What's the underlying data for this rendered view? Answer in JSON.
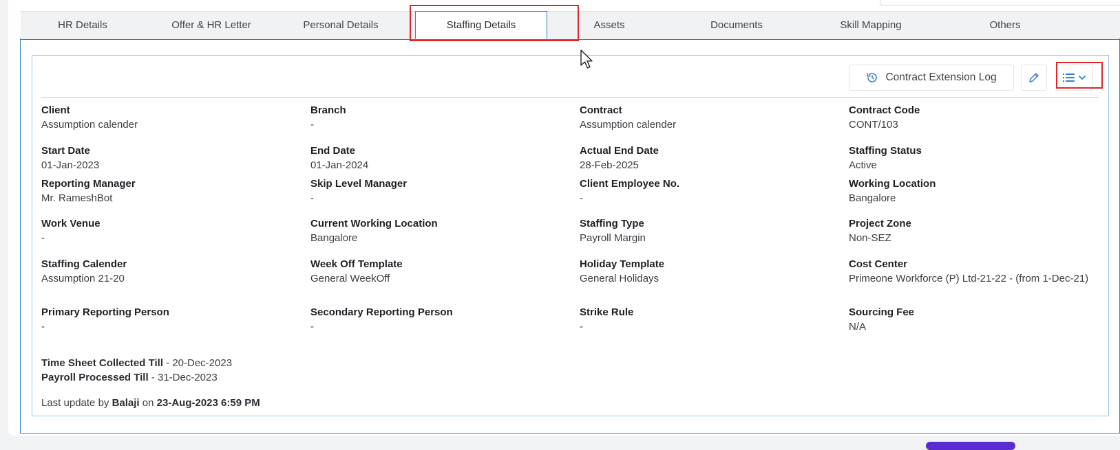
{
  "tabs": [
    {
      "label": "HR Details",
      "active": false
    },
    {
      "label": "Offer & HR Letter",
      "active": false
    },
    {
      "label": "Personal Details",
      "active": false
    },
    {
      "label": "Staffing Details",
      "active": true
    },
    {
      "label": "Assets",
      "active": false
    },
    {
      "label": "Documents",
      "active": false
    },
    {
      "label": "Skill Mapping",
      "active": false
    },
    {
      "label": "Others",
      "active": false
    }
  ],
  "toolbar": {
    "contract_log_label": "Contract Extension Log",
    "contract_log_icon": "history-icon",
    "edit_icon": "pencil-icon",
    "menu_icon": "list-icon",
    "menu_chevron_icon": "chevron-down-icon"
  },
  "fields": [
    {
      "label": "Client",
      "value": "Assumption calender"
    },
    {
      "label": "Branch",
      "value": "-"
    },
    {
      "label": "Contract",
      "value": "Assumption calender"
    },
    {
      "label": "Contract Code",
      "value": "CONT/103"
    },
    {
      "label": "Start Date",
      "value": "01-Jan-2023"
    },
    {
      "label": "End Date",
      "value": "01-Jan-2024"
    },
    {
      "label": "Actual End Date",
      "value": "28-Feb-2025"
    },
    {
      "label": "Staffing Status",
      "value": "Active"
    },
    {
      "label": "Reporting Manager",
      "value": "Mr. RameshBot"
    },
    {
      "label": "Skip Level Manager",
      "value": "-"
    },
    {
      "label": "Client Employee No.",
      "value": "-"
    },
    {
      "label": "Working Location",
      "value": "Bangalore"
    },
    {
      "label": "Work Venue",
      "value": "-"
    },
    {
      "label": "Current Working Location",
      "value": "Bangalore"
    },
    {
      "label": "Staffing Type",
      "value": "Payroll Margin"
    },
    {
      "label": "Project Zone",
      "value": "Non-SEZ"
    },
    {
      "label": "Staffing Calender",
      "value": "Assumption 21-20"
    },
    {
      "label": "Week Off Template",
      "value": "General WeekOff"
    },
    {
      "label": "Holiday Template",
      "value": "General Holidays"
    },
    {
      "label": "Cost Center",
      "value": "Primeone Workforce (P) Ltd-21-22 - (from 1-Dec-21)"
    },
    {
      "label": "Primary Reporting Person",
      "value": "-"
    },
    {
      "label": "Secondary Reporting Person",
      "value": "-"
    },
    {
      "label": "Strike Rule",
      "value": "-"
    },
    {
      "label": "Sourcing Fee",
      "value": "N/A"
    }
  ],
  "footer": {
    "timesheet_label": "Time Sheet Collected Till",
    "timesheet_value": " - 20-Dec-2023",
    "payroll_label": "Payroll Processed Till",
    "payroll_value": " - 31-Dec-2023",
    "update_prefix": "Last update by ",
    "update_user": "Balaji",
    "update_on": " on ",
    "update_time": "23-Aug-2023 6:59 PM"
  },
  "colors": {
    "accent": "#2f7fd1",
    "highlight": "#e0262b"
  }
}
